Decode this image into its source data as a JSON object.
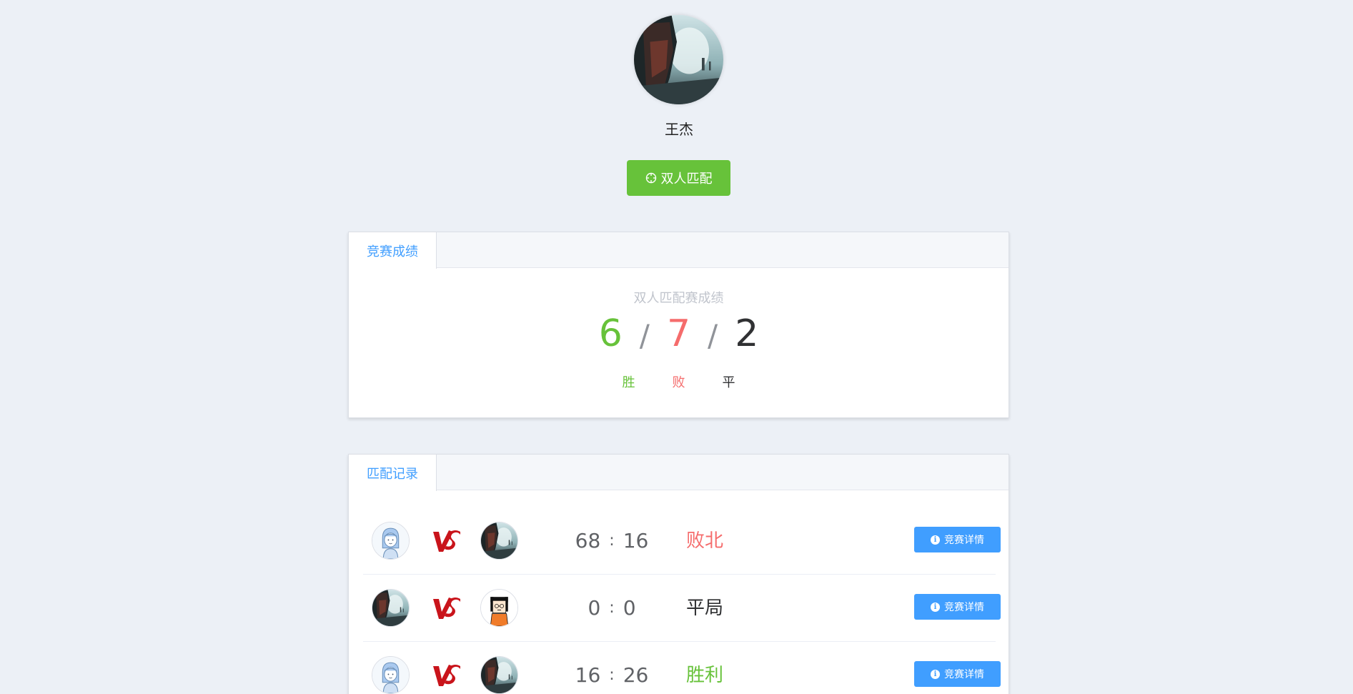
{
  "profile": {
    "username": "王杰",
    "avatar_icon": "user-avatar-landscape"
  },
  "actions": {
    "match_label": "双人匹配",
    "match_icon": "crosshair-icon"
  },
  "stats_card": {
    "tab_label": "竞赛成绩",
    "title": "双人匹配赛成绩",
    "wins": "6",
    "losses": "7",
    "draws": "2",
    "separator": "/",
    "win_label": "胜",
    "loss_label": "败",
    "draw_label": "平"
  },
  "history_card": {
    "tab_label": "匹配记录",
    "detail_label": "竞赛详情",
    "detail_icon": "info-icon",
    "rows": [
      {
        "player_a": "girl-avatar",
        "player_b": "landscape-avatar",
        "score_a": "68",
        "score_b": "16",
        "result": "败北"
      },
      {
        "player_a": "landscape-avatar",
        "player_b": "cartoon-avatar",
        "score_a": "0",
        "score_b": "0",
        "result": "平局"
      },
      {
        "player_a": "girl-avatar",
        "player_b": "landscape-avatar",
        "score_a": "16",
        "score_b": "26",
        "result": "胜利"
      }
    ]
  },
  "colors": {
    "win": "#67c23a",
    "loss": "#f56c6c",
    "primary": "#409eff",
    "background": "#ecf0f6"
  }
}
